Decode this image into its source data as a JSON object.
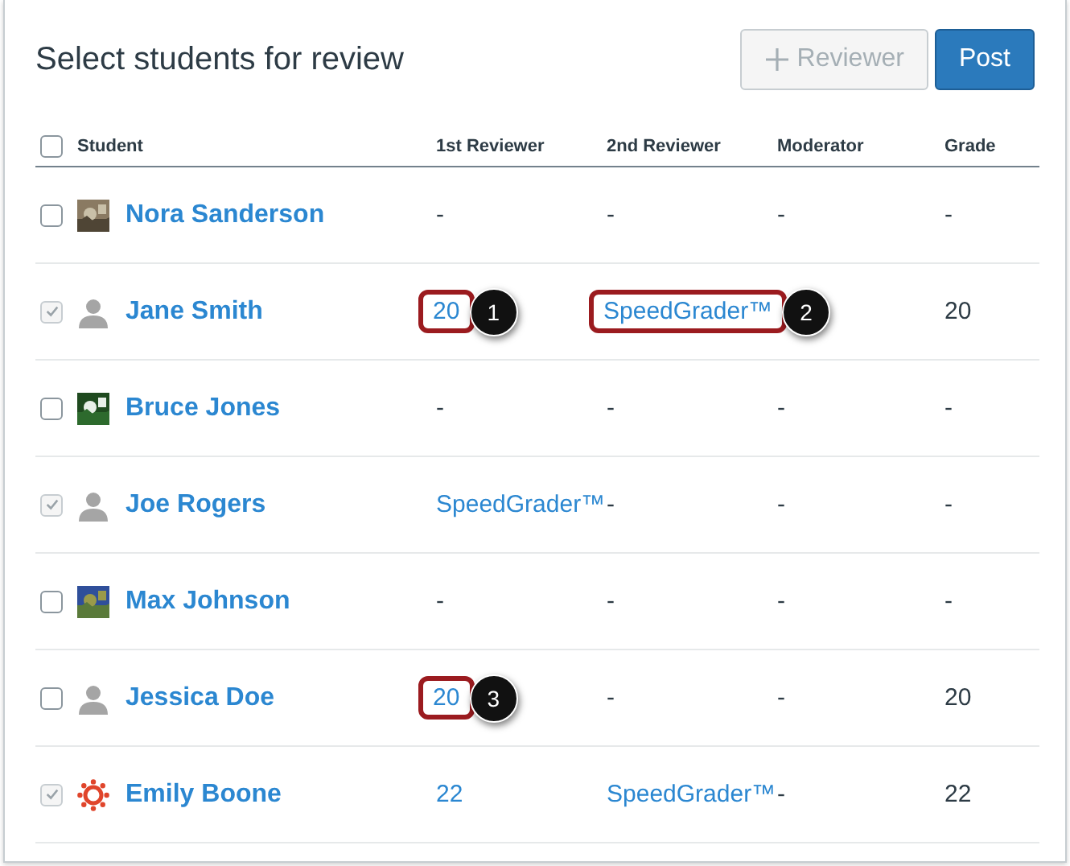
{
  "title": "Select students for review",
  "buttons": [
    {
      "label": "Reviewer",
      "disabled": true,
      "kind": "secondary"
    },
    {
      "label": "Post",
      "disabled": false,
      "kind": "primary"
    }
  ],
  "table": {
    "select_all": {
      "checked": false
    },
    "columns": [
      "Student",
      "1st Reviewer",
      "2nd Reviewer",
      "Moderator",
      "Grade"
    ],
    "rows": [
      {
        "checked": false,
        "disabled": false,
        "cells": [
          {
            "text": "Nora Sanderson",
            "kind": "student"
          },
          {
            "text": "-",
            "kind": "text"
          },
          {
            "text": "-",
            "kind": "text"
          },
          {
            "text": "-",
            "kind": "text"
          },
          {
            "text": "-",
            "kind": "text"
          }
        ]
      },
      {
        "checked": true,
        "disabled": true,
        "cells": [
          {
            "text": "Jane Smith",
            "kind": "student",
            "avatar": {
              "kind": "placeholder"
            }
          },
          {
            "text": "20",
            "kind": "link",
            "callout": "1"
          },
          {
            "text": "SpeedGrader™",
            "kind": "link",
            "callout": "2"
          },
          {
            "kind": "empty"
          },
          {
            "text": "20",
            "kind": "text"
          }
        ]
      },
      {
        "checked": false,
        "disabled": false,
        "cells": [
          {
            "text": "Bruce Jones",
            "kind": "student"
          },
          {
            "text": "-",
            "kind": "text"
          },
          {
            "text": "-",
            "kind": "text"
          },
          {
            "text": "-",
            "kind": "text"
          },
          {
            "text": "-",
            "kind": "text"
          }
        ]
      },
      {
        "checked": true,
        "disabled": true,
        "cells": [
          {
            "text": "Joe Rogers",
            "kind": "student",
            "avatar": {
              "kind": "placeholder"
            }
          },
          {
            "text": "SpeedGrader™",
            "kind": "link"
          },
          {
            "text": "-",
            "kind": "text"
          },
          {
            "text": "-",
            "kind": "text"
          },
          {
            "text": "-",
            "kind": "text"
          }
        ]
      },
      {
        "checked": false,
        "disabled": false,
        "cells": [
          {
            "text": "Max Johnson",
            "kind": "student"
          },
          {
            "text": "-",
            "kind": "text"
          },
          {
            "text": "-",
            "kind": "text"
          },
          {
            "text": "-",
            "kind": "text"
          },
          {
            "text": "-",
            "kind": "text"
          }
        ]
      },
      {
        "checked": false,
        "disabled": false,
        "cells": [
          {
            "text": "Jessica Doe",
            "kind": "student",
            "avatar": {
              "kind": "placeholder"
            }
          },
          {
            "text": "20",
            "kind": "link",
            "callout": "3"
          },
          {
            "text": "-",
            "kind": "text"
          },
          {
            "text": "-",
            "kind": "text"
          },
          {
            "text": "20",
            "kind": "text"
          }
        ]
      },
      {
        "checked": true,
        "disabled": true,
        "cells": [
          {
            "text": "Emily Boone",
            "kind": "student",
            "avatar": {
              "kind": "logo"
            }
          },
          {
            "text": "22",
            "kind": "link"
          },
          {
            "text": "SpeedGrader™",
            "kind": "link"
          },
          {
            "text": "-",
            "kind": "text"
          },
          {
            "text": "22",
            "kind": "text"
          }
        ]
      }
    ]
  }
}
